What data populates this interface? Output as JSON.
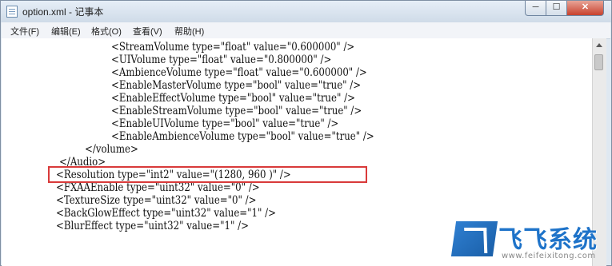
{
  "window": {
    "title": "option.xml - 记事本",
    "controls": {
      "minimize": "─",
      "maximize": "☐",
      "close": "✕"
    }
  },
  "menubar": {
    "items": [
      "文件(F)",
      "编辑(E)",
      "格式(O)",
      "查看(V)",
      "帮助(H)"
    ]
  },
  "editor": {
    "lines": [
      "<StreamVolume type=\"float\" value=\"0.600000\" />",
      "<UIVolume type=\"float\" value=\"0.800000\" />",
      "<AmbienceVolume type=\"float\" value=\"0.600000\" />",
      "<EnableMasterVolume type=\"bool\" value=\"true\" />",
      "<EnableEffectVolume type=\"bool\" value=\"true\" />",
      "<EnableStreamVolume type=\"bool\" value=\"true\" />",
      "<EnableUIVolume type=\"bool\" value=\"true\" />",
      "<EnableAmbienceVolume type=\"bool\" value=\"true\" />",
      "</volume>",
      "</Audio>",
      "<Resolution type=\"int2\" value=\"(1280, 960 )\" />",
      "<FXAAEnable type=\"uint32\" value=\"0\" />",
      "<TextureSize type=\"uint32\" value=\"0\" />",
      "<BackGlowEffect type=\"uint32\" value=\"1\" />",
      "<BlurEffect type=\"uint32\" value=\"1\" />"
    ],
    "highlighted_line": "<Resolution type=\"int2\" value=\"(1280, 960 )\" />"
  },
  "watermark": {
    "brand": "飞飞系统",
    "url": "www.feifeixitong.com"
  }
}
